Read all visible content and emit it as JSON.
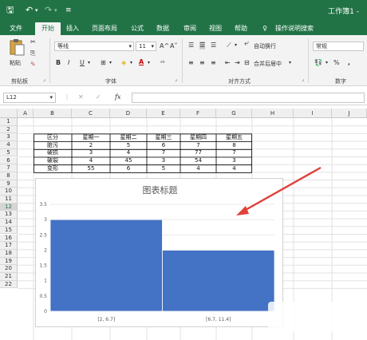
{
  "qat": {
    "save": "🖫",
    "undo": "↶",
    "undo_drop": "▾",
    "redo": "↷",
    "redo_drop": "▾",
    "customize": "≡"
  },
  "window_title": "工作簿1 -",
  "tabs": [
    "文件",
    "开始",
    "插入",
    "页面布局",
    "公式",
    "数据",
    "审阅",
    "视图",
    "帮助"
  ],
  "tell_me": "操作说明搜索",
  "ribbon": {
    "clipboard": {
      "paste": "粘贴",
      "label": "剪贴板"
    },
    "font": {
      "name": "等线",
      "size": "11",
      "grow": "A^",
      "shrink": "A˅",
      "bold": "B",
      "italic": "I",
      "underline": "U",
      "label": "字体"
    },
    "alignment": {
      "wrap": "自动换行",
      "merge": "合并后居中",
      "label": "对齐方式"
    },
    "number": {
      "format": "常规",
      "percent": "%",
      "comma": ",",
      "label": "数字"
    }
  },
  "name_box": "L12",
  "fx_label": "fx",
  "columns": [
    "A",
    "B",
    "C",
    "D",
    "E",
    "F",
    "G",
    "H",
    "I",
    "J"
  ],
  "rows": [
    "1",
    "2",
    "3",
    "4",
    "5",
    "6",
    "7",
    "8",
    "9",
    "10",
    "11",
    "12",
    "13",
    "14",
    "15",
    "16",
    "17",
    "18",
    "19",
    "20",
    "21",
    "22"
  ],
  "table": {
    "headers": [
      "区分",
      "星期一",
      "星期二",
      "星期三",
      "星期四",
      "星期五"
    ],
    "rows": [
      [
        "脏污",
        "2",
        "5",
        "6",
        "7",
        "8"
      ],
      [
        "破损",
        "3",
        "4",
        "7",
        "77",
        "7"
      ],
      [
        "破裂",
        "4",
        "45",
        "3",
        "54",
        "3"
      ],
      [
        "变形",
        "55",
        "6",
        "5",
        "4",
        "4"
      ]
    ]
  },
  "chart_data": {
    "type": "bar",
    "title": "图表标题",
    "categories": [
      "[2, 6.7]",
      "[6.7, 11.4]"
    ],
    "values": [
      3,
      2
    ],
    "ylim": [
      0,
      3.5
    ],
    "yticks": [
      "0",
      "0.5",
      "1",
      "1.5",
      "2",
      "2.5",
      "3",
      "3.5"
    ],
    "grid": true,
    "bar_color": "#4472c4"
  },
  "colors": {
    "excel_green": "#217346",
    "arrow_red": "#e0423a"
  }
}
